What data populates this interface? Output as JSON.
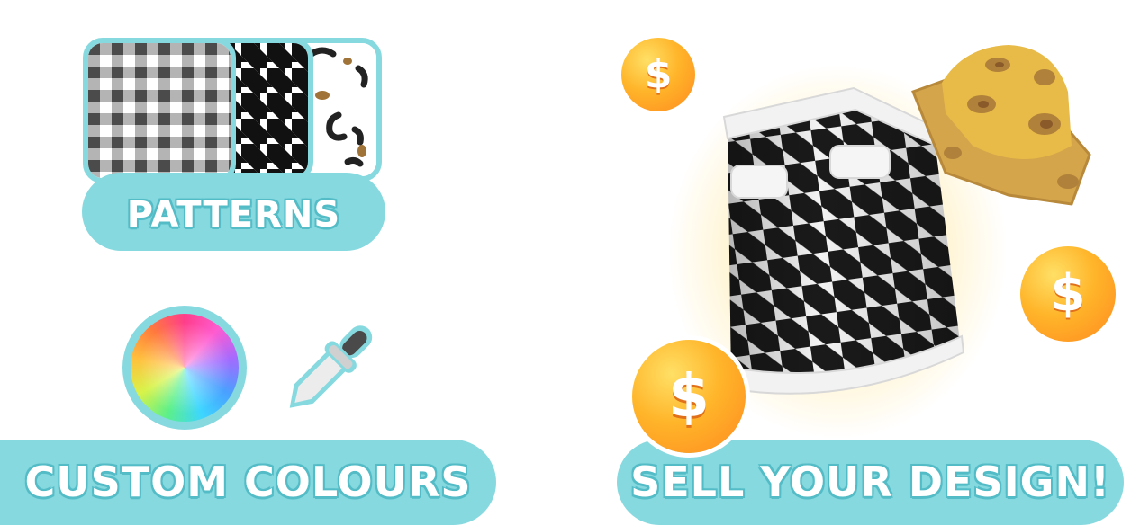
{
  "labels": {
    "patterns": "PATTERNS",
    "custom_colours": "CUSTOM COLOURS",
    "sell_design": "SELL YOUR DESIGN!"
  },
  "coin_symbol": "$",
  "colors": {
    "accent": "#86d9df",
    "accent_dark": "#55bdc7",
    "coin_orange": "#ff9a1f",
    "coin_yellow": "#ffd02a",
    "hat_gold": "#e6b53a"
  },
  "icons": {
    "gingham_swatch": "gingham-pattern-icon",
    "houndstooth_swatch": "houndstooth-pattern-icon",
    "leopard_swatch": "leopard-pattern-icon",
    "color_wheel": "color-wheel-icon",
    "eyedropper": "eyedropper-icon",
    "skirt": "houndstooth-skirt-icon",
    "hat": "leopard-bucket-hat-icon",
    "coin": "dollar-coin-icon"
  }
}
